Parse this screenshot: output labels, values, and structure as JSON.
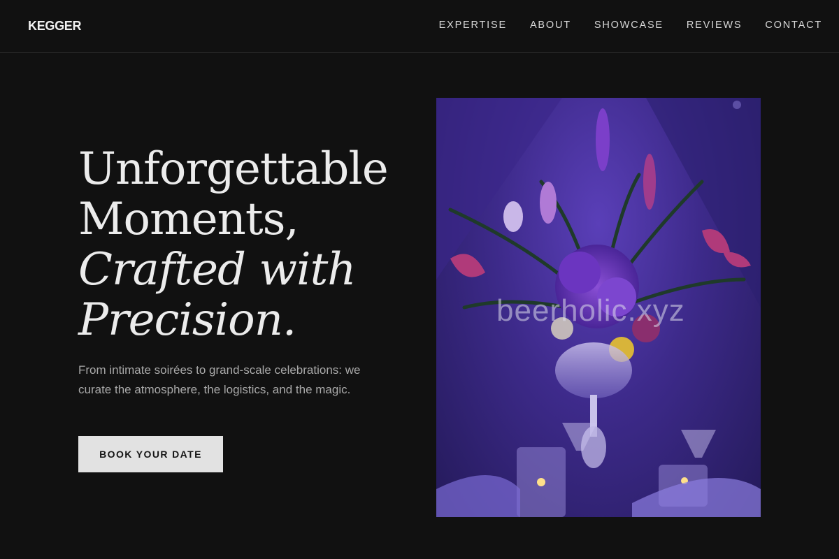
{
  "brand": "KEGGER",
  "nav": {
    "items": [
      "EXPERTISE",
      "ABOUT",
      "SHOWCASE",
      "REVIEWS",
      "CONTACT"
    ]
  },
  "hero": {
    "headline_line1": "Unforgettable",
    "headline_line2": "Moments,",
    "headline_line3": "Crafted with",
    "headline_line4": "Precision.",
    "subtext": "From intimate soirées to grand-scale celebrations: we curate the atmosphere, the logistics, and the magic.",
    "cta_label": "BOOK YOUR DATE"
  },
  "image": {
    "watermark": "beerholic.xyz",
    "icon": "floral-centerpiece-photo"
  },
  "colors": {
    "background": "#111111",
    "button_bg": "#e2e2e2",
    "photo_tint": "#3d2a8a"
  }
}
